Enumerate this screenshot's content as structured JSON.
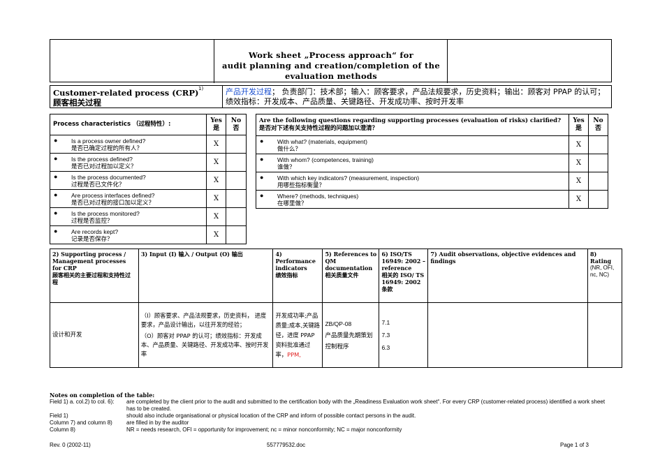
{
  "header": {
    "title_l1": "Work sheet „Process approach“ for",
    "title_l2": "audit planning and creation/completion of the",
    "title_l3": "evaluation methods"
  },
  "crp": {
    "label_en": "Customer-related process (CRP)",
    "sup": "1)",
    "label_cn": "顾客相关过程",
    "process_name": "产品开发过程",
    "process_rest": "；  负责部门：技术部；输入：顾客要求，产品法规要求，历史资料；输出：顾客对 PPAP 的认可；绩效指标：开发成本、产品质量、关键路径、开发成功率、按时开发率"
  },
  "left_table": {
    "head": "Process characteristics    （过程特性）:",
    "yes": "Yes",
    "yes_cn": "是",
    "no": "No",
    "no_cn": "否",
    "rows": [
      {
        "en": "Is a process owner defined?",
        "cn": "是否已确定过程的所有人？",
        "mark": "X"
      },
      {
        "en": "Is the process defined?",
        "cn": "是否已对过程加以定义？",
        "mark": "X"
      },
      {
        "en": "Is the process documented?",
        "cn": "过程是否已文件化？",
        "mark": "X"
      },
      {
        "en": "Are process interfaces defined?",
        "cn": "是否已对过程的接口加以定义？",
        "mark": "X"
      },
      {
        "en": "Is the process monitored?",
        "cn": "过程是否监控？",
        "mark": "X"
      },
      {
        "en": "Are records kept?",
        "cn": "记录是否保存？",
        "mark": "X"
      }
    ]
  },
  "right_table": {
    "head_en": "Are the following questions regarding supporting processes (evaluation of risks) clarified?",
    "head_cn": "是否对下述有关支持性过程的问题加以澄清？",
    "yes": "Yes",
    "yes_cn": "是",
    "no": "No",
    "no_cn": "否",
    "rows": [
      {
        "en": "With what? (materials, equipment)",
        "cn": "做什么？",
        "mark": "X"
      },
      {
        "en": "With whom? (competences, training)",
        "cn": "谁做？",
        "mark": "X"
      },
      {
        "en": "With which key indicators? (measurement, inspection)",
        "cn": "用哪些指标衡量？",
        "mark": "X"
      },
      {
        "en": "Where? (methods, techniques)",
        "cn": "在哪里做？",
        "mark": "X"
      }
    ]
  },
  "big_table": {
    "h1": "2)  Supporting process / Management processes for CRP",
    "h1_cn": "顾客相关的主要过程和支持性过程",
    "h2": "3)  Input (I) 输入 / Output (O) 输出",
    "h3": "4) Performance indicators",
    "h3_cn": "绩效指标",
    "h4": "5) References to QM documentation",
    "h4_cn": "相关质量文件",
    "h5": "6) ISO/TS 16949: 2002 – reference",
    "h5_cn": "相关的 ISO/ TS 16949: 2002 条款",
    "h6": "7)  Audit observations, objective evidences and findings",
    "h7": "8) Rating",
    "h7_sub": "(NR, OFI, nc, NC)",
    "row": {
      "process": "设计和开发",
      "input": "（I）顾客要求、产品法规要求，历史资料，  进度要求，产品设计输出，以往开发的经验；",
      "output": "（O）顾客对 PPAP 的认可；绩效指标：开发成本、产品质量、关键路径、开发成功率、按时开发率",
      "kpi": "开发成功率;产品质量;成本,关键路径，进度 PPAP 资料批准通过率，",
      "kpi_red": "PPM,",
      "ref_code": "ZB/QP-08",
      "ref_name": "产品质量先期策划控制程序",
      "clauses": [
        "7.1",
        "7.3",
        "6.3"
      ]
    }
  },
  "notes": {
    "title": "Notes on completion of the table:",
    "items": [
      {
        "label": "Field 1) a. col.2) to col. 6):",
        "text": "are completed by the client prior to the audit and submitted to the certification body with the „Readiness Evaluation work sheet“. For every CRP (customer-related process) identified a work sheet has to be created."
      },
      {
        "label": "Field 1)",
        "text": "should also include organisational or physical location of the CRP and inform of possible contact persons in the audit."
      },
      {
        "label": "Column 7) and column 8)",
        "text": "are filled in by the auditor"
      },
      {
        "label": "Column 8)",
        "text": "NR = needs research, OFI = opportunity for improvement; nc = minor nonconformity; NC = major nonconformity"
      }
    ]
  },
  "footer": {
    "rev": "Rev. 0  (2002-11)",
    "doc": "557779532.doc",
    "page": "Page 1 of 3"
  },
  "colors": {
    "accent_blue": "#1a4fd0",
    "red": "#e02020"
  }
}
